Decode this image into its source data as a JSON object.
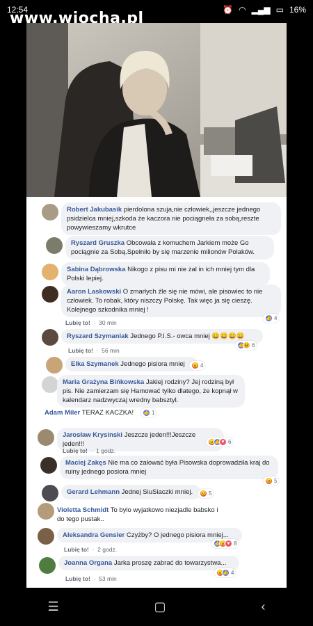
{
  "status": {
    "time": "12:54",
    "battery": "16%"
  },
  "watermark": "www.wiocha.pl",
  "comments": [
    {
      "name": "Robert Jakubasik",
      "text": "pierdolona szuja,nie człowiek,,jeszcze jednego psidzielca mniej,szkoda że kaczora nie pociągneła za sobą,reszte powywieszamy wkrutce"
    },
    {
      "name": "Ryszard Gruszka",
      "text": "Obcowała z komuchem Jarkiem może Go pociągnie za Sobą.Spełniło by się marzenie milionów Polaków."
    },
    {
      "name": "Sabina Dąbrowska",
      "text": "Nikogo z pisu mi nie żal in ich mniej tym dla Polski lepiej."
    },
    {
      "name": "Aaron Laskowski",
      "text": "O zmarłych źle się nie mówi, ale pisowiec to nie człowiek. To robak, który niszczy Polskę. Tak więc ja się cieszę. Kolejnego szkodnika mniej !",
      "like": "Lubię to!",
      "time": "30 min",
      "reaction_count": "4"
    },
    {
      "name": "Ryszard Szymaniak",
      "text": "Jednego P.I.S.- owca mniej",
      "like": "Lubię to!",
      "time": "56 min",
      "reaction_count": "6"
    },
    {
      "name": "Elka Szymanek",
      "text": "Jednego pisiora mniej",
      "reaction_count": "4"
    },
    {
      "name": "Maria Grażyna Bińkowska",
      "text": "Jakiej rodziny? Jej rodziną był pis. Nie zamierzam się Hamować tylko dlatego, że kopnął w kalendarz nadzwyczaj wredny babsztyl."
    },
    {
      "name": "Adam Miler",
      "text": "TERAZ KACZKA!",
      "reaction_count": "1"
    },
    {
      "name": "Jarosław Krysinski",
      "text": "Jeszcze jeden!!!Jeszcze jeden!!!",
      "like": "Lubię to!",
      "time": "1 godz.",
      "reaction_count": "6"
    },
    {
      "name": "Maciej Zakęs",
      "text": "Nie ma co żałować była Pisowska doprowadziła kraj do ruiny jednego posiora mniej",
      "reaction_count": "5"
    },
    {
      "name": "Gerard Lehmann",
      "text": "Jednej SiuSiaczki mniej.",
      "reaction_count": "5"
    },
    {
      "name": "Violetta Schmidt",
      "text": "To bylo wyjatkowo niezjadle babsko i do tego pustak.."
    },
    {
      "name": "Aleksandra Gensler",
      "text": "Czyżby? O jednego pisiora mniej...",
      "like": "Lubię to!",
      "time": "2 godz.",
      "reaction_count": "8"
    },
    {
      "name": "Joanna Organa",
      "text": "Jarka proszę zabrać do towarzystwa...",
      "like": "Lubię to!",
      "time": "53 min",
      "reaction_count": "4"
    }
  ]
}
